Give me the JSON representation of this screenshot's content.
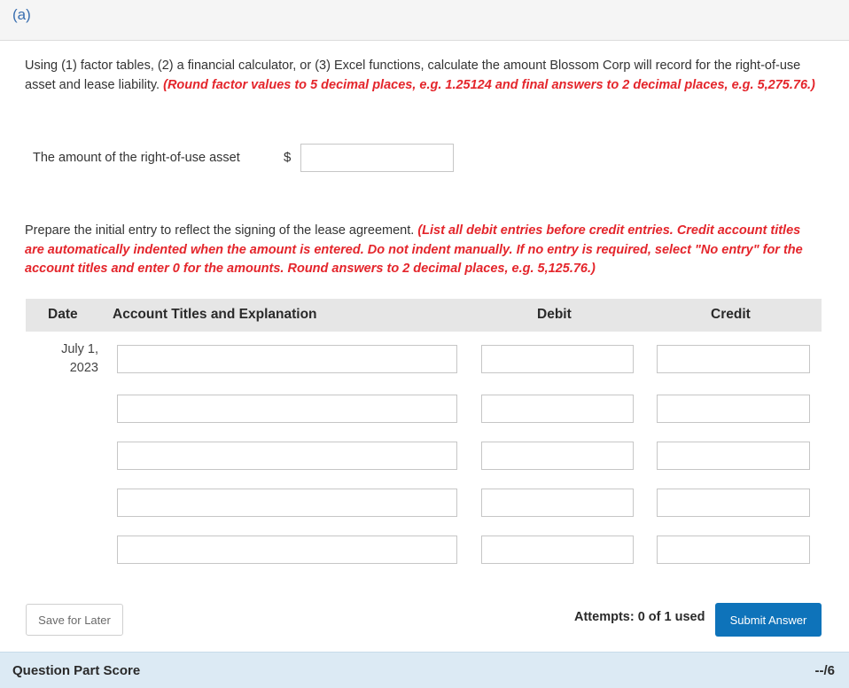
{
  "part": {
    "label": "(a)"
  },
  "instructions": {
    "text": "Using (1) factor tables, (2) a financial calculator, or (3) Excel functions, calculate the amount Blossom Corp will record for the right-of-use asset and lease liability.",
    "note": "(Round factor values to 5 decimal places, e.g. 1.25124 and final answers to 2 decimal places, e.g. 5,275.76.)"
  },
  "rou": {
    "label": "The amount of the right-of-use asset",
    "currency": "$",
    "value": ""
  },
  "entry": {
    "text": "Prepare the initial entry to reflect the signing of the lease agreement.",
    "note": "(List all debit entries before credit entries. Credit account titles are automatically indented when the amount is entered. Do not indent manually. If no entry is required, select \"No entry\" for the account titles and enter 0 for the amounts. Round answers to 2 decimal places, e.g. 5,125.76.)"
  },
  "journal": {
    "headers": {
      "date": "Date",
      "account": "Account Titles and Explanation",
      "debit": "Debit",
      "credit": "Credit"
    },
    "date_line1": "July 1,",
    "date_line2": "2023",
    "rows": [
      {
        "account": "",
        "debit": "",
        "credit": ""
      },
      {
        "account": "",
        "debit": "",
        "credit": ""
      },
      {
        "account": "",
        "debit": "",
        "credit": ""
      },
      {
        "account": "",
        "debit": "",
        "credit": ""
      },
      {
        "account": "",
        "debit": "",
        "credit": ""
      }
    ]
  },
  "actions": {
    "save_label": "Save for Later",
    "attempts": "Attempts: 0 of 1 used",
    "submit_label": "Submit Answer"
  },
  "score": {
    "label": "Question Part Score",
    "value": "--/6"
  }
}
